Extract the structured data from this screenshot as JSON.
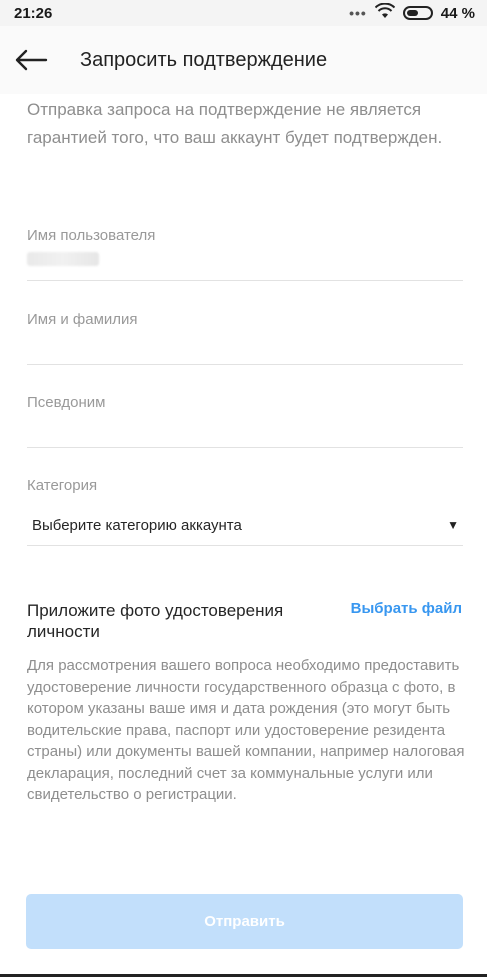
{
  "status_bar": {
    "time": "21:26",
    "battery": "44 %"
  },
  "header": {
    "title": "Запросить подтверждение"
  },
  "intro_text": "Отправка запроса на подтверждение не является гарантией того, что ваш аккаунт будет подтвержден.",
  "form": {
    "username_label": "Имя пользователя",
    "fullname_label": "Имя и фамилия",
    "fullname_value": "",
    "alias_label": "Псевдоним",
    "alias_value": "",
    "category_label": "Категория",
    "category_selected": "Выберите категорию аккаунта",
    "category_caret": "▼"
  },
  "attach": {
    "title": "Приложите фото удостоверения личности",
    "choose_file": "Выбрать файл",
    "description": "Для рассмотрения вашего вопроса необходимо предоставить удостоверение личности государственного образца с фото, в котором указаны ваше имя и дата рождения (это могут быть водительские права, паспорт или удостоверение резидента страны) или документы вашей компании, например налоговая декларация, последний счет за коммунальные услуги или свидетельство о регистрации."
  },
  "submit_label": "Отправить",
  "colors": {
    "accent": "#3897f0",
    "button_disabled": "#c2dffb",
    "muted_text": "#8e8e8e"
  },
  "icons": {
    "back": "arrow-left-icon",
    "wifi": "wifi-icon",
    "battery": "battery-icon",
    "more": "dots-icon"
  }
}
